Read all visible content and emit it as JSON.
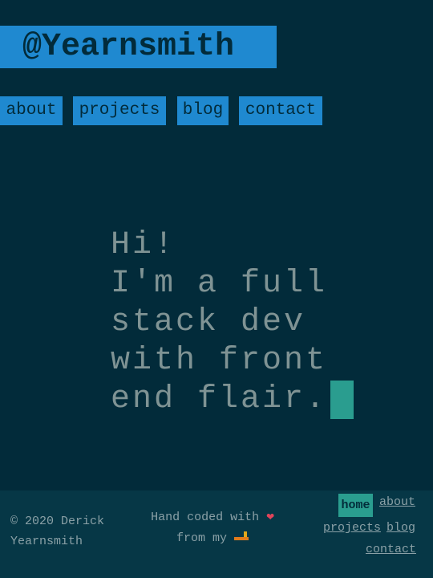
{
  "header": {
    "site_title": "@Yearnsmith"
  },
  "nav": {
    "items": [
      {
        "label": "about"
      },
      {
        "label": "projects"
      },
      {
        "label": "blog"
      },
      {
        "label": "contact"
      }
    ]
  },
  "hero": {
    "lines": [
      "Hi!",
      "I'm a full",
      "stack dev",
      "with front",
      "end flair."
    ]
  },
  "footer": {
    "copyright_line1": "© 2020 Derick",
    "copyright_line2": "Yearnsmith",
    "made_with_line1": "Hand coded with",
    "made_with_line2": "from my",
    "heart_icon": "sparkling-heart-icon",
    "laptop_icon": "laptop-icon",
    "nav": {
      "home": "home",
      "about": "about",
      "projects": "projects",
      "blog": "blog",
      "contact": "contact"
    }
  },
  "colors": {
    "background": "#022b3a",
    "accent_blue": "#1f89d0",
    "accent_teal": "#2a9d8f",
    "text_muted": "#7f9394",
    "footer_bg": "#063746"
  }
}
